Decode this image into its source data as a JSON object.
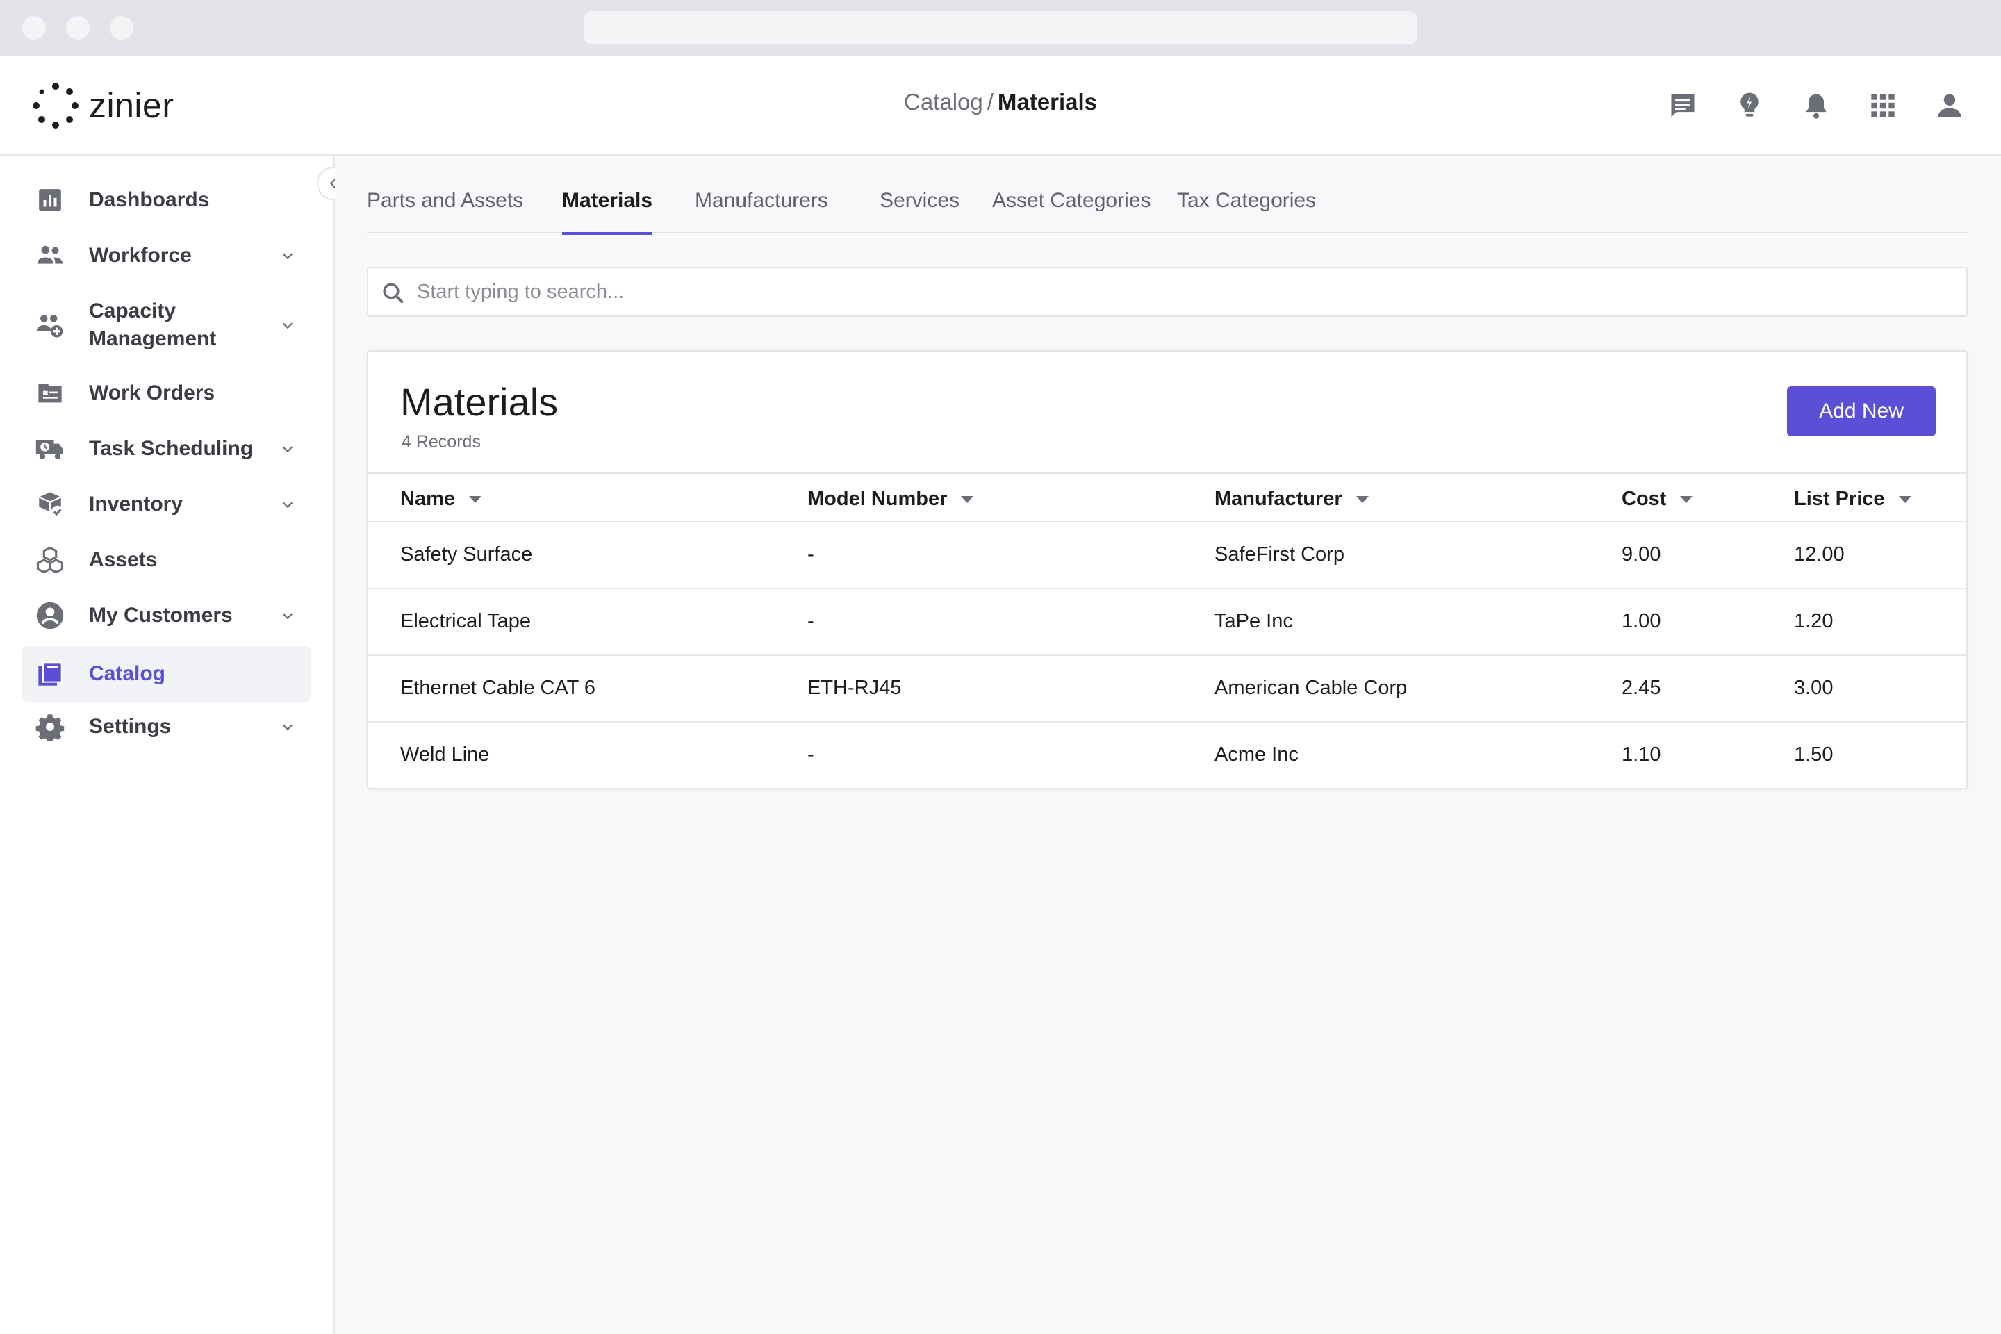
{
  "header": {
    "logo_text": "zinier",
    "breadcrumb_parent": "Catalog",
    "breadcrumb_separator": "/",
    "breadcrumb_current": "Materials",
    "icons": [
      "chat-icon",
      "lightbulb-icon",
      "bell-icon",
      "apps-grid-icon",
      "user-icon"
    ]
  },
  "sidebar": {
    "items": [
      {
        "label": "Dashboards",
        "icon": "bar-chart-icon",
        "has_children": false
      },
      {
        "label": "Workforce",
        "icon": "people-icon",
        "has_children": true
      },
      {
        "label": "Capacity Management",
        "icon": "people-add-icon",
        "has_children": true
      },
      {
        "label": "Work Orders",
        "icon": "folder-list-icon",
        "has_children": false
      },
      {
        "label": "Task Scheduling",
        "icon": "truck-clock-icon",
        "has_children": true
      },
      {
        "label": "Inventory",
        "icon": "box-check-icon",
        "has_children": true
      },
      {
        "label": "Assets",
        "icon": "cubes-icon",
        "has_children": false
      },
      {
        "label": "My Customers",
        "icon": "account-circle-icon",
        "has_children": true
      },
      {
        "label": "Catalog",
        "icon": "book-icon",
        "has_children": false,
        "active": true
      },
      {
        "label": "Settings",
        "icon": "gear-icon",
        "has_children": true
      }
    ]
  },
  "tabs": [
    {
      "label": "Parts and Assets"
    },
    {
      "label": "Materials",
      "active": true
    },
    {
      "label": "Manufacturers"
    },
    {
      "label": "Services"
    },
    {
      "label": "Asset Categories"
    },
    {
      "label": "Tax Categories"
    }
  ],
  "search": {
    "placeholder": "Start typing to search..."
  },
  "card": {
    "title": "Materials",
    "record_count": "4 Records",
    "add_label": "Add New"
  },
  "table": {
    "columns": [
      "Name",
      "Model Number",
      "Manufacturer",
      "Cost",
      "List Price"
    ],
    "rows": [
      [
        "Safety Surface",
        "-",
        "SafeFirst Corp",
        "9.00",
        "12.00"
      ],
      [
        "Electrical Tape",
        "-",
        "TaPe Inc",
        "1.00",
        "1.20"
      ],
      [
        "Ethernet Cable CAT 6",
        "ETH-RJ45",
        "American Cable Corp",
        "2.45",
        "3.00"
      ],
      [
        "Weld Line",
        "-",
        "Acme Inc",
        "1.10",
        "1.50"
      ]
    ]
  },
  "colors": {
    "accent": "#5a4fd6",
    "icon_gray": "#6b6e76",
    "background": "#f8f8fa"
  }
}
